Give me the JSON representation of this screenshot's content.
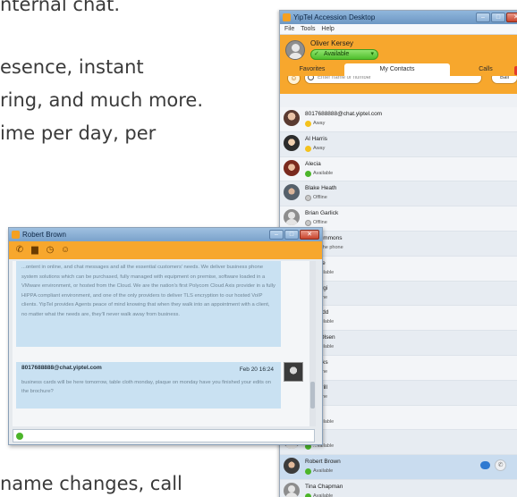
{
  "article": {
    "line1": "nternal chat.",
    "line2": "esence, instant",
    "line3": "ring, and much more.",
    "line4": "ime per day, per",
    "line5": "name changes, call"
  },
  "accession": {
    "title": "YipTel Accession Desktop",
    "menu": [
      "File",
      "Tools",
      "Help"
    ],
    "user_name": "Oliver Kersey",
    "status": "Available",
    "search_placeholder": "Enter name or number",
    "dial_label": "Ball",
    "tabs": [
      "Favorites",
      "My Contacts",
      "Calls"
    ],
    "active_tab": "My Contacts",
    "contacts": [
      {
        "name": "8017688888@chat.yiptel.com",
        "status": "Away",
        "state": "away",
        "avatar": "photo1"
      },
      {
        "name": "Al Harris",
        "status": "Away",
        "state": "away",
        "avatar": "photo2"
      },
      {
        "name": "Alecia",
        "status": "Available",
        "state": "available",
        "avatar": "photo3"
      },
      {
        "name": "Blake Heath",
        "status": "Offline",
        "state": "offline",
        "avatar": "photo4"
      },
      {
        "name": "Brian Garlick",
        "status": "Offline",
        "state": "offline",
        "avatar": "generic"
      },
      {
        "name": "...he Simmons",
        "status": "...n the phone",
        "state": "onphone",
        "avatar": "generic"
      },
      {
        "name": "...vence",
        "status": "...vailable",
        "state": "available",
        "avatar": "generic"
      },
      {
        "name": "...is Gygi",
        "status": "...ffline",
        "state": "offline",
        "avatar": "generic"
      },
      {
        "name": "...y Gadd",
        "status": "...vailable",
        "state": "available",
        "avatar": "generic"
      },
      {
        "name": "...ron Olsen",
        "status": "...vailable",
        "state": "available",
        "avatar": "generic"
      },
      {
        "name": "...Brooks",
        "status": "...ffline",
        "state": "offline",
        "avatar": "generic"
      },
      {
        "name": "... Morrill",
        "status": "...ffline",
        "state": "offline",
        "avatar": "generic"
      },
      {
        "name": "...ently",
        "status": "...vailable",
        "state": "available",
        "avatar": "generic"
      },
      {
        "name": "...e",
        "status": "...vailable",
        "state": "available",
        "avatar": "generic"
      },
      {
        "name": "Robert Brown",
        "status": "Available",
        "state": "available",
        "avatar": "photo5",
        "selected": true
      },
      {
        "name": "Tina Chapman",
        "status": "Available",
        "state": "available",
        "avatar": "generic"
      }
    ]
  },
  "chat": {
    "title": "Robert Brown",
    "message1_body": "...ontent in online, and chat messages and all the essential customers' needs. We deliver business phone system solutions which can be purchased, fully managed with equipment on premise, software loaded in a VMware environment, or hosted from the Cloud. We are the nation's first Polycom Cloud Axis provider in a fully HIPPA compliant environment, and one of the only providers to deliver TLS encryption to our hosted VoIP clients. YipTel provides Agents peace of mind knowing that when they walk into an appointment with a client, no matter what the needs are, they'll never walk away from business.",
    "message2_from": "8017688888@chat.yiptel.com",
    "message2_time": "Feb 20 16:24",
    "message2_body": "business cards will be here tomorrow, table cloth monday, plaque on monday have you finished your edits on the brochure?",
    "colors": {
      "accent": "#f7a72d",
      "bubble": "#c9e1f2"
    }
  }
}
